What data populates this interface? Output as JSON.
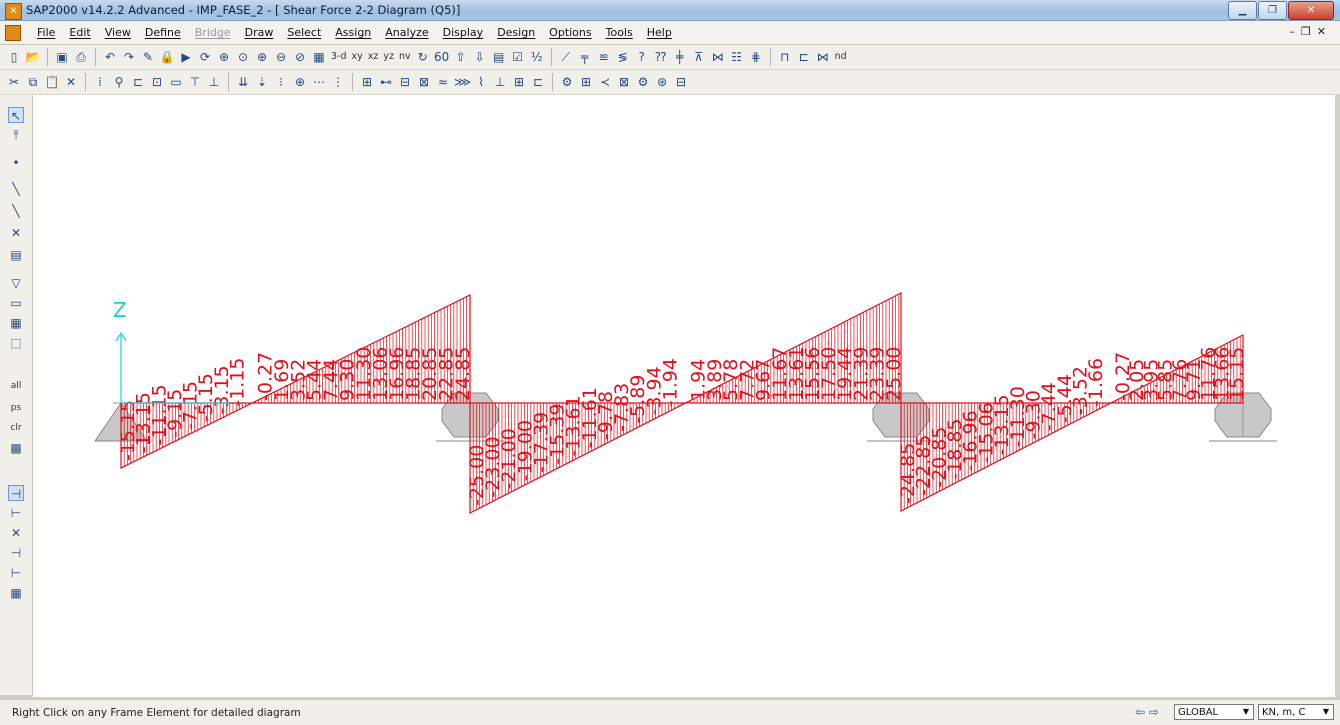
{
  "window": {
    "title": "SAP2000 v14.2.2 Advanced  - IMP_FASE_2 - [ Shear Force 2-2 Diagram  (Q5)]"
  },
  "menus": [
    "File",
    "Edit",
    "View",
    "Define",
    "Bridge",
    "Draw",
    "Select",
    "Assign",
    "Analyze",
    "Display",
    "Design",
    "Options",
    "Tools",
    "Help"
  ],
  "disabled_menu": "Bridge",
  "toolbar_text": {
    "view_3d": "3-d",
    "view_xy": "xy",
    "view_xz": "xz",
    "view_yz": "yz",
    "view_nv": "nv",
    "nd": "nd"
  },
  "left_tools": {
    "all": "all",
    "ps": "ps",
    "clr": "clr"
  },
  "axis": {
    "label": "Z"
  },
  "diagram": {
    "color": "#e0101c",
    "label_font_size": 19,
    "spans": [
      {
        "labels_neg": [
          "-15.15",
          "-13.15",
          "-11.15",
          "-9.15",
          "-7.15",
          "-5.15",
          "-3.15",
          "-1.15"
        ],
        "labels_pos": [
          "-0.27",
          "1.69",
          "3.52",
          "5.44",
          "7.44",
          "9.30",
          "11.30",
          "13.06",
          "16.96",
          "18.85",
          "20.85",
          "22.85",
          "24.85"
        ]
      },
      {
        "labels_neg": [
          "-25.00",
          "-23.00",
          "-21.00",
          "-19.00",
          "-17.39",
          "-15.39",
          "-13.61",
          "-11.61",
          "-9.78",
          "-7.83",
          "-5.89",
          "-3.94",
          "-1.94"
        ],
        "labels_pos": [
          "1.94",
          "3.89",
          "5.78",
          "7.72",
          "9.67",
          "11.67",
          "13.61",
          "15.56",
          "17.50",
          "19.44",
          "21.39",
          "23.39",
          "25.00"
        ]
      },
      {
        "labels_neg": [
          "-24.85",
          "-22.85",
          "-20.85",
          "-18.85",
          "-16.96",
          "-15.06",
          "-13.15",
          "-11.30",
          "-9.30",
          "-7.44",
          "-5.44",
          "-3.52",
          "-1.66"
        ],
        "labels_pos": [
          "-0.27",
          "2.05",
          "3.95",
          "5.85",
          "7.76",
          "9.71",
          "11.76",
          "13.66",
          "15.15"
        ]
      }
    ]
  },
  "status": {
    "message": "Right Click on any Frame Element for detailed diagram",
    "coord_system": "GLOBAL",
    "units": "KN, m, C"
  }
}
